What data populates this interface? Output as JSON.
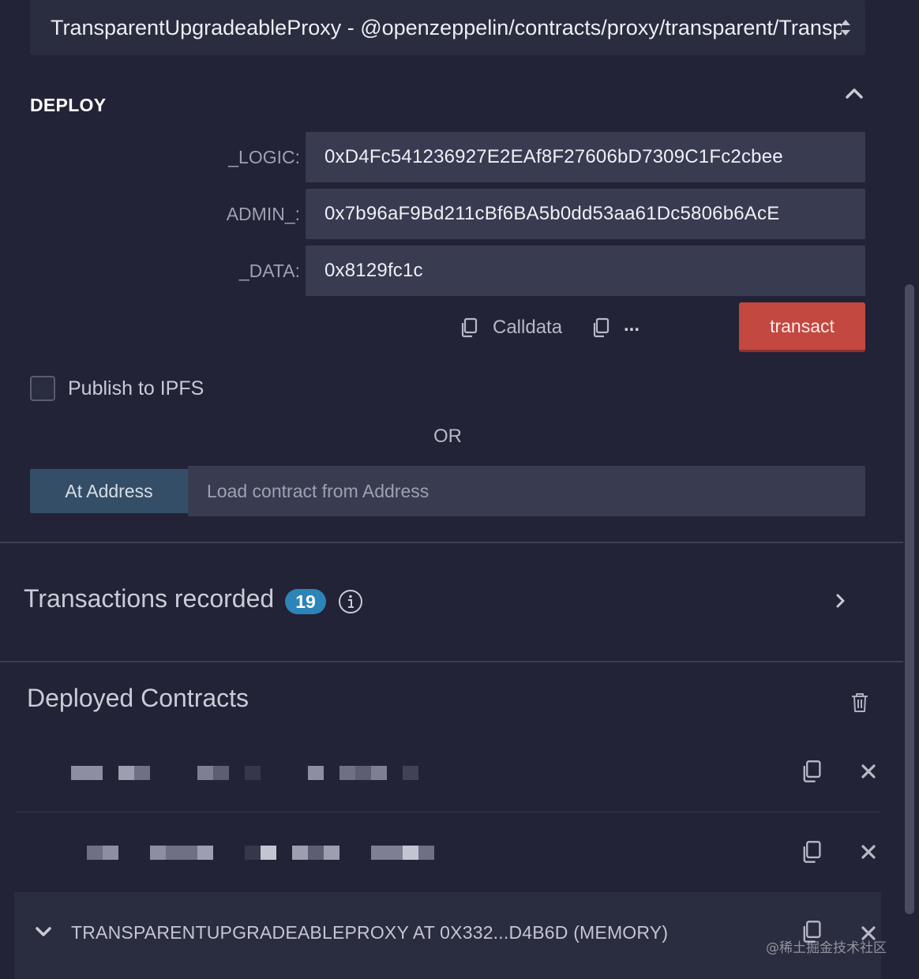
{
  "contract_select": {
    "value": "TransparentUpgradeableProxy - @openzeppelin/contracts/proxy/transparent/TransparentUpgradeableProxy.sol"
  },
  "deploy": {
    "title": "DEPLOY",
    "params": [
      {
        "label": "_LOGIC:",
        "value": "0xD4Fc541236927E2EAf8F27606bD7309C1Fc2cbee"
      },
      {
        "label": "ADMIN_:",
        "value": "0x7b96aF9Bd211cBf6BA5b0dd53aa61Dc5806b6AcE"
      },
      {
        "label": "_DATA:",
        "value": "0x8129fc1c"
      }
    ],
    "calldata_label": "Calldata",
    "more_label": "...",
    "transact_label": "transact"
  },
  "publish": {
    "label": "Publish to IPFS",
    "checked": false
  },
  "or_label": "OR",
  "at_address": {
    "button_label": "At Address",
    "placeholder": "Load contract from Address"
  },
  "transactions": {
    "title": "Transactions recorded",
    "count": "19"
  },
  "deployed": {
    "title": "Deployed Contracts",
    "expanded_contract": "TRANSPARENTUPGRADEABLEPROXY AT 0X332...D4B6D (MEMORY)"
  },
  "watermark": "@稀土掘金技术社区",
  "colors": {
    "background": "#222336",
    "input": "#393b51",
    "transact": "#c3483f",
    "at_address": "#334e66",
    "badge": "#2d84b9"
  }
}
